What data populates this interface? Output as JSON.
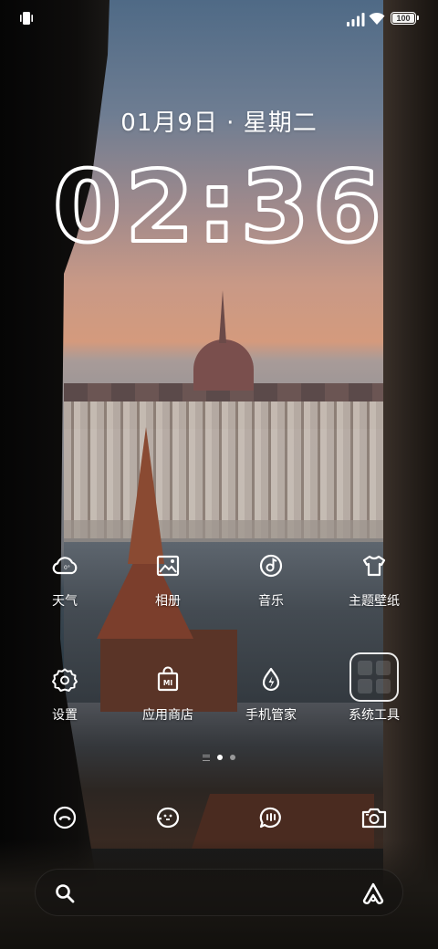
{
  "status_bar": {
    "battery": "100",
    "icons": [
      "vibrate-icon",
      "signal-icon",
      "wifi-icon",
      "battery-icon"
    ]
  },
  "lock": {
    "date": "01月9日 · 星期二",
    "time": "02:36"
  },
  "apps": [
    {
      "label": "天气",
      "icon": "weather-cloud-icon"
    },
    {
      "label": "相册",
      "icon": "gallery-icon"
    },
    {
      "label": "音乐",
      "icon": "music-icon"
    },
    {
      "label": "主题壁纸",
      "icon": "theme-shirt-icon"
    },
    {
      "label": "设置",
      "icon": "settings-gear-icon"
    },
    {
      "label": "应用商店",
      "icon": "mi-store-icon"
    },
    {
      "label": "手机管家",
      "icon": "security-icon"
    },
    {
      "label": "系统工具",
      "icon": "folder-icon"
    }
  ],
  "page_indicator": {
    "pages": 2,
    "active": 1
  },
  "dock": [
    {
      "icon": "phone-icon"
    },
    {
      "icon": "contacts-bird-icon"
    },
    {
      "icon": "messages-icon"
    },
    {
      "icon": "camera-icon"
    }
  ],
  "search": {
    "icons": [
      "search-icon",
      "assistant-icon"
    ]
  }
}
